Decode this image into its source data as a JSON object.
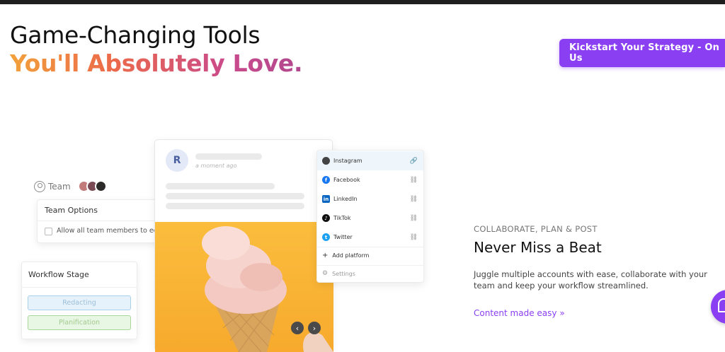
{
  "hero": {
    "title_line1": "Game-Changing Tools",
    "title_line2": "You'll Absolutely Love.",
    "cta_label": "Kickstart Your Strategy - On Us"
  },
  "team_panel": {
    "label": "Team",
    "options_title": "Team Options",
    "checkbox_label": "Allow all team members to edit"
  },
  "workflow": {
    "title": "Workflow Stage",
    "stages": [
      "Redacting",
      "Planification"
    ]
  },
  "post": {
    "avatar_letter": "R",
    "meta": "a moment ago"
  },
  "platforms": {
    "items": [
      {
        "name": "Instagram",
        "color": "#444444",
        "icon": "instagram-icon"
      },
      {
        "name": "Facebook",
        "color": "#1877f2",
        "icon": "facebook-icon"
      },
      {
        "name": "LinkedIn",
        "color": "#0a66c2",
        "icon": "linkedin-icon"
      },
      {
        "name": "TikTok",
        "color": "#111111",
        "icon": "tiktok-icon"
      },
      {
        "name": "Twitter",
        "color": "#1da1f2",
        "icon": "twitter-icon"
      }
    ],
    "add_label": "Add platform",
    "settings_label": "Settings"
  },
  "feature": {
    "eyebrow": "COLLABORATE, PLAN & POST",
    "heading": "Never Miss a Beat",
    "description": "Juggle multiple accounts with ease, collaborate with your team and keep your workflow streamlined.",
    "link_label": "Content made easy",
    "link_icon": "double-chevron-right-icon"
  },
  "colors": {
    "accent": "#8a3ff2",
    "gradient_start": "#f2a13b",
    "gradient_end": "#b1488f"
  }
}
